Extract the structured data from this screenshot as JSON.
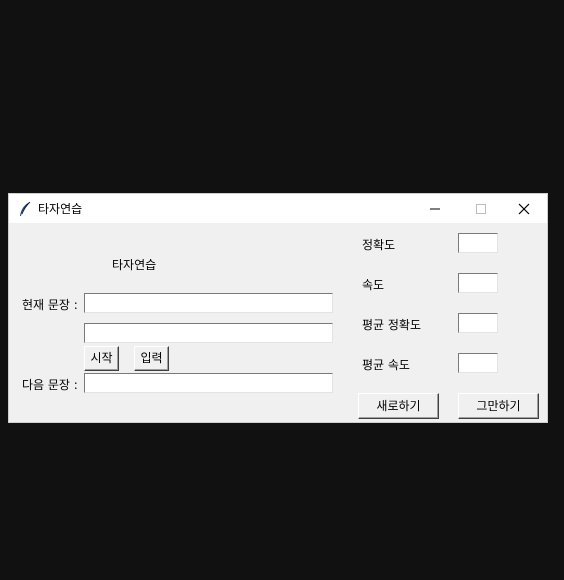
{
  "window": {
    "title": "타자연습",
    "minimize_glyph": "–",
    "maximize_glyph": "□",
    "close_glyph": "✕"
  },
  "left": {
    "heading": "타자연습",
    "current_label": "현재 문장 :",
    "next_label": "다음 문장 :",
    "current_value": "",
    "input_value": "",
    "next_value": "",
    "start_label": "시작",
    "enter_label": "입력"
  },
  "right": {
    "accuracy_label": "정확도",
    "speed_label": "속도",
    "avg_accuracy_label": "평균 정확도",
    "avg_speed_label": "평균 속도",
    "accuracy_value": "",
    "speed_value": "",
    "avg_accuracy_value": "",
    "avg_speed_value": "",
    "refresh_label": "새로하기",
    "quit_label": "그만하기"
  }
}
